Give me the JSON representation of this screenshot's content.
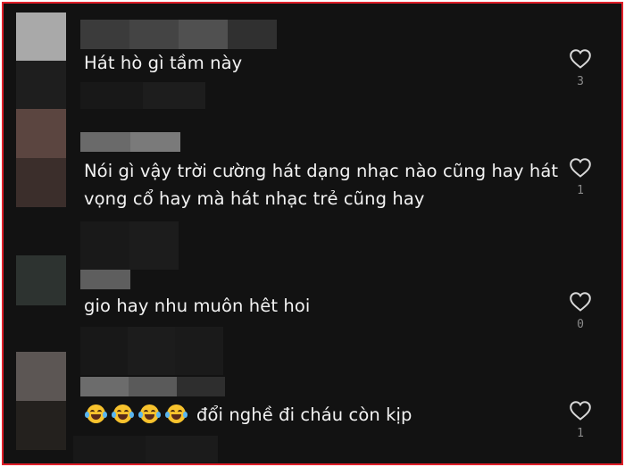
{
  "comments": [
    {
      "text": "Hát hò gì tầm này",
      "likes": "3"
    },
    {
      "text_line1": "Nói gì vậy trời cường hát dạng nhạc nào cũng hay hát",
      "text_line2": "vọng cổ hay mà hát nhạc trẻ cũng hay",
      "likes": "1"
    },
    {
      "text": "gio hay nhu muôn hêt hoi",
      "likes": "0"
    },
    {
      "emojis": [
        "laughing-tears",
        "laughing-tears",
        "laughing-tears",
        "laughing-tears"
      ],
      "text": "đổi nghề đi cháu còn kịp",
      "likes": "1"
    }
  ],
  "icons": {
    "like": "heart-outline-icon"
  },
  "colors": {
    "frame_border": "#e0202a",
    "background": "#121212",
    "text": "#f2f2f2",
    "count": "#8a8a8a"
  }
}
